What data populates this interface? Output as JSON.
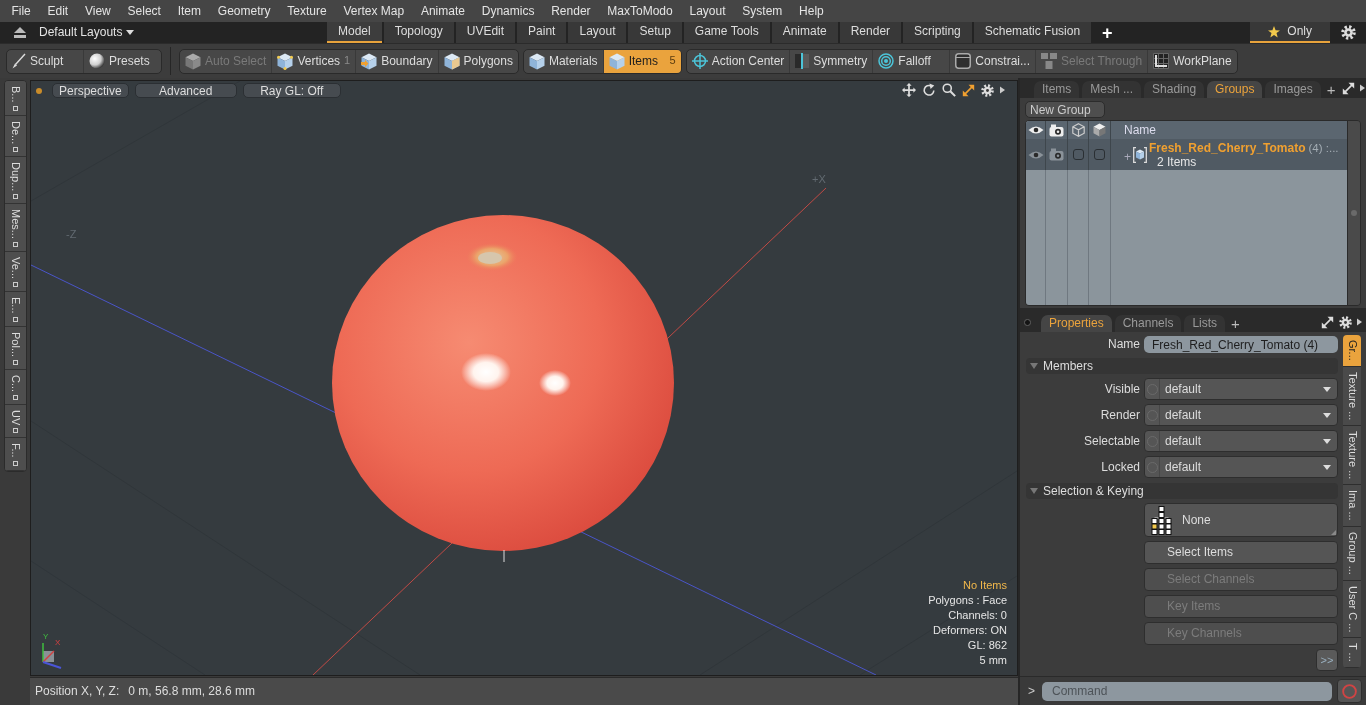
{
  "menu_bar": [
    "File",
    "Edit",
    "View",
    "Select",
    "Item",
    "Geometry",
    "Texture",
    "Vertex Map",
    "Animate",
    "Dynamics",
    "Render",
    "MaxToModo",
    "Layout",
    "System",
    "Help"
  ],
  "layout_bar": {
    "layout_menu": "Default Layouts",
    "tabs": [
      {
        "label": "Model",
        "selected": true
      },
      {
        "label": "Topology",
        "selected": false
      },
      {
        "label": "UVEdit",
        "selected": false
      },
      {
        "label": "Paint",
        "selected": false
      },
      {
        "label": "Layout",
        "selected": false
      },
      {
        "label": "Setup",
        "selected": false
      },
      {
        "label": "Game Tools",
        "selected": false
      },
      {
        "label": "Animate",
        "selected": false
      },
      {
        "label": "Render",
        "selected": false
      },
      {
        "label": "Scripting",
        "selected": false
      },
      {
        "label": "Schematic Fusion",
        "selected": false
      }
    ],
    "add_tab": "+",
    "only_toggle": {
      "label": "Only",
      "on": true
    }
  },
  "toolbar": {
    "groups": [
      {
        "items": [
          {
            "label": "Sculpt",
            "selected": false,
            "disabled": false
          },
          {
            "label": "Presets",
            "selected": false,
            "disabled": false
          }
        ]
      },
      {
        "items": [
          {
            "label": "Auto Select",
            "selected": false,
            "disabled": true
          },
          {
            "label": "Vertices",
            "count": "1",
            "selected": false,
            "disabled": false
          },
          {
            "label": "Boundary",
            "selected": false,
            "disabled": false
          },
          {
            "label": "Polygons",
            "selected": false,
            "disabled": false
          }
        ]
      },
      {
        "items": [
          {
            "label": "Materials",
            "selected": false,
            "disabled": false
          },
          {
            "label": "Items",
            "count": "5",
            "selected": true,
            "disabled": false
          }
        ]
      },
      {
        "items": [
          {
            "label": "Action Center",
            "selected": false,
            "disabled": false
          },
          {
            "label": "Symmetry",
            "selected": false,
            "disabled": false
          },
          {
            "label": "Falloff",
            "selected": false,
            "disabled": false
          },
          {
            "label": "Constrai...",
            "selected": false,
            "disabled": false
          },
          {
            "label": "Select Through",
            "selected": false,
            "disabled": true
          },
          {
            "label": "WorkPlane",
            "selected": false,
            "disabled": false
          }
        ]
      }
    ]
  },
  "left_tabs": [
    "B...",
    "De...",
    "Dup...",
    "Mes...",
    "Ve...",
    "E...",
    "Pol...",
    "C...",
    "UV",
    "F..."
  ],
  "viewport": {
    "header_buttons": [
      "Perspective",
      "Advanced",
      "Ray GL: Off"
    ],
    "axis_labels": [
      "-Z",
      "+X"
    ],
    "gizmo_labels": [
      "Y",
      "X"
    ],
    "info": {
      "status": "No Items",
      "lines": [
        "Polygons : Face",
        "Channels: 0",
        "Deformers: ON",
        "GL: 862",
        "5 mm"
      ]
    }
  },
  "status_bar": {
    "label": "Position X, Y, Z:",
    "value": "0 m, 56.8 mm, 28.6 mm"
  },
  "groups_panel": {
    "tabs": [
      {
        "label": "Items",
        "selected": false
      },
      {
        "label": "Mesh ...",
        "selected": false
      },
      {
        "label": "Shading",
        "selected": false
      },
      {
        "label": "Groups",
        "selected": true
      },
      {
        "label": "Images",
        "selected": false
      }
    ],
    "add_tab": "+",
    "new_group_button": "New Group",
    "table": {
      "name_column": "Name",
      "rows": [
        {
          "expander": "+",
          "name": "Fresh_Red_Cherry_Tomato",
          "suffix": "(4) :...",
          "detail": "2 Items",
          "checks": [
            {
              "checked": false
            },
            {
              "checked": false
            }
          ]
        }
      ]
    }
  },
  "properties_panel": {
    "tabs": [
      {
        "label": "Properties",
        "selected": true
      },
      {
        "label": "Channels",
        "selected": false
      },
      {
        "label": "Lists",
        "selected": false
      }
    ],
    "add_tab": "+",
    "name_label": "Name",
    "name_value": "Fresh_Red_Cherry_Tomato (4)",
    "sections": [
      {
        "title": "Members",
        "expanded": true,
        "fields": [
          {
            "label": "Visible",
            "value": "default"
          },
          {
            "label": "Render",
            "value": "default"
          },
          {
            "label": "Selectable",
            "value": "default"
          },
          {
            "label": "Locked",
            "value": "default"
          }
        ]
      },
      {
        "title": "Selection & Keying",
        "expanded": true,
        "buttons": [
          {
            "label": "None",
            "kind": "preset",
            "disabled": false
          },
          {
            "label": "Select Items",
            "kind": "action",
            "disabled": false
          },
          {
            "label": "Select Channels",
            "kind": "action",
            "disabled": true
          },
          {
            "label": "Key Items",
            "kind": "action",
            "disabled": true
          },
          {
            "label": "Key Channels",
            "kind": "action",
            "disabled": true
          }
        ]
      }
    ],
    "more_button": ">>",
    "side_tabs": [
      {
        "label": "Gr...",
        "selected": true
      },
      {
        "label": "Texture ...",
        "selected": false
      },
      {
        "label": "Texture ...",
        "selected": false
      },
      {
        "label": "Ima ...",
        "selected": false
      },
      {
        "label": "Group ...",
        "selected": false
      },
      {
        "label": "User C ...",
        "selected": false
      },
      {
        "label": "T ...",
        "selected": false
      }
    ]
  },
  "command_bar": {
    "prompt": ">",
    "placeholder": "Command"
  }
}
